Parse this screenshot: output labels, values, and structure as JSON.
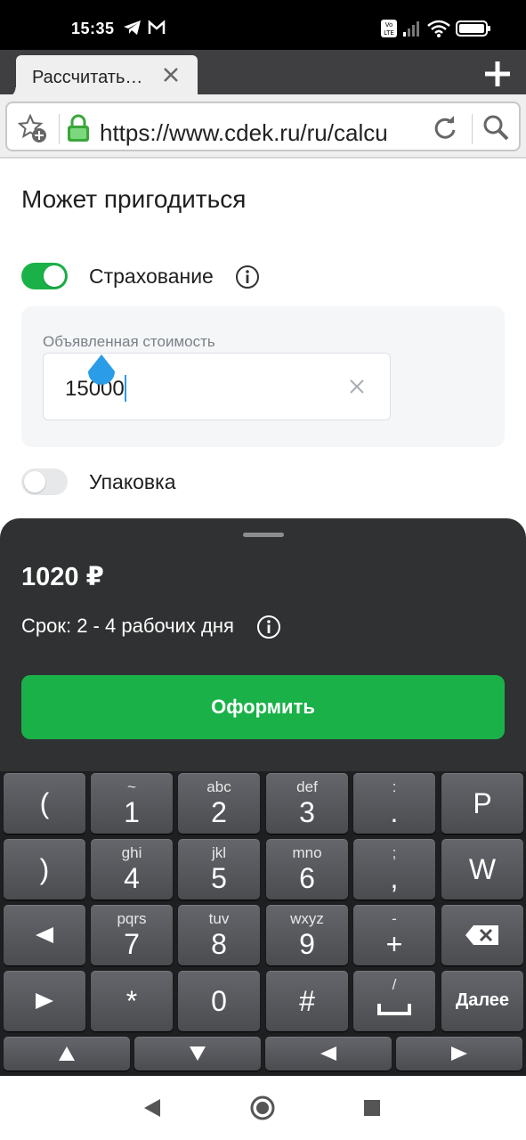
{
  "status_bar": {
    "time": "15:35",
    "icons": [
      "telegram-icon",
      "gmail-icon",
      "volte-icon",
      "signal-icon",
      "wifi-icon",
      "battery-icon"
    ]
  },
  "browser": {
    "tab_title": "Рассчитать…",
    "url": "https://www.cdek.ru/ru/calcu"
  },
  "page": {
    "section_title": "Может пригодиться",
    "insurance": {
      "label": "Страхование",
      "enabled": true
    },
    "declared_value": {
      "label": "Объявленная стоимость",
      "value": "15000"
    },
    "packaging": {
      "label": "Упаковка",
      "enabled": false
    }
  },
  "sheet": {
    "price": "1020 ₽",
    "term": "Срок: 2 - 4 рабочих дня",
    "submit_label": "Оформить"
  },
  "keyboard": {
    "rows": [
      [
        {
          "main": "("
        },
        {
          "sub": "~",
          "main": "1"
        },
        {
          "sub": "abc",
          "main": "2"
        },
        {
          "sub": "def",
          "main": "3"
        },
        {
          "sub": ":",
          "main": "."
        },
        {
          "main": "P"
        }
      ],
      [
        {
          "main": ")"
        },
        {
          "sub": "ghi",
          "main": "4"
        },
        {
          "sub": "jkl",
          "main": "5"
        },
        {
          "sub": "mno",
          "main": "6"
        },
        {
          "sub": ";",
          "main": ","
        },
        {
          "main": "W"
        }
      ],
      [
        {
          "icon": "left-triangle-icon"
        },
        {
          "sub": "pqrs",
          "main": "7"
        },
        {
          "sub": "tuv",
          "main": "8"
        },
        {
          "sub": "wxyz",
          "main": "9"
        },
        {
          "sub": "-",
          "main": "+"
        },
        {
          "icon": "backspace-icon"
        }
      ],
      [
        {
          "icon": "right-triangle-icon"
        },
        {
          "main": "*"
        },
        {
          "main": "0"
        },
        {
          "main": "#"
        },
        {
          "sub": "/",
          "icon": "space-icon"
        },
        {
          "main": "Далее"
        }
      ]
    ],
    "arrow_keys": [
      "arrow-up-icon",
      "arrow-down-icon",
      "arrow-left-icon",
      "arrow-right-icon"
    ]
  },
  "nav_bar": {
    "buttons": [
      "back-icon",
      "home-icon",
      "recents-icon"
    ]
  },
  "colors": {
    "accent_green": "#1ab248",
    "sheet_bg": "#303132",
    "caret_blue": "#2a9ce8"
  }
}
